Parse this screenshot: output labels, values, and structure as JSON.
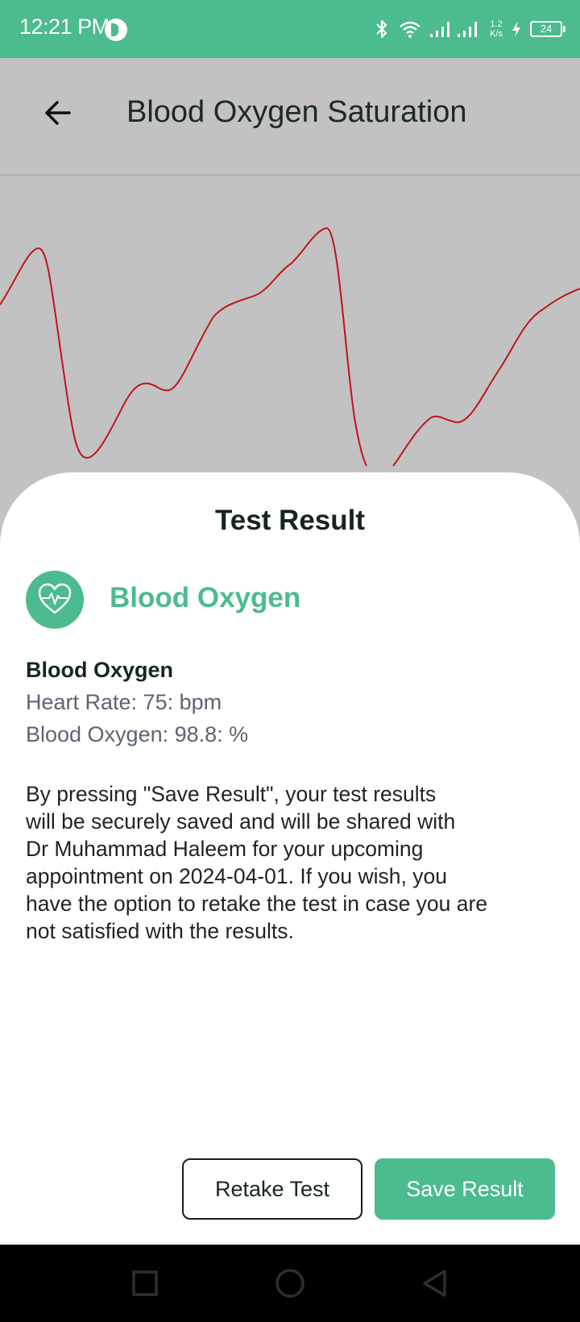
{
  "status_bar": {
    "time": "12:21 PM",
    "net_speed_value": "1.2",
    "net_speed_unit": "K/s",
    "battery": "24",
    "icons": [
      "bluetooth-icon",
      "wifi-icon",
      "signal-icon",
      "charging-icon",
      "battery-icon"
    ]
  },
  "app_bar": {
    "back_icon": "arrow-left-icon",
    "title": "Blood Oxygen Saturation"
  },
  "waveform": {
    "line_color": "#c0141c",
    "background": "#c2c2c2"
  },
  "result_sheet": {
    "title": "Test Result",
    "icon": "heart-pulse-icon",
    "heading": "Blood Oxygen",
    "details": {
      "title": "Blood Oxygen",
      "heart_rate": "Heart Rate: 75: bpm",
      "blood_oxygen": "Blood Oxygen: 98.8: %"
    },
    "disclaimer": "By pressing \"Save Result\", your test results\nwill be securely saved and will be shared with\nDr Muhammad Haleem for your upcoming\nappointment on 2024-04-01. If you wish, you\nhave the option to retake the test in case you are\nnot satisfied with the results.",
    "buttons": {
      "retake": "Retake Test",
      "save": "Save Result"
    }
  },
  "colors": {
    "accent": "#4cbb8d",
    "text_dark": "#15271d",
    "text_muted": "#5d6470"
  },
  "nav_bar": {
    "icons": [
      "recents-square-icon",
      "home-circle-icon",
      "back-triangle-icon"
    ]
  }
}
